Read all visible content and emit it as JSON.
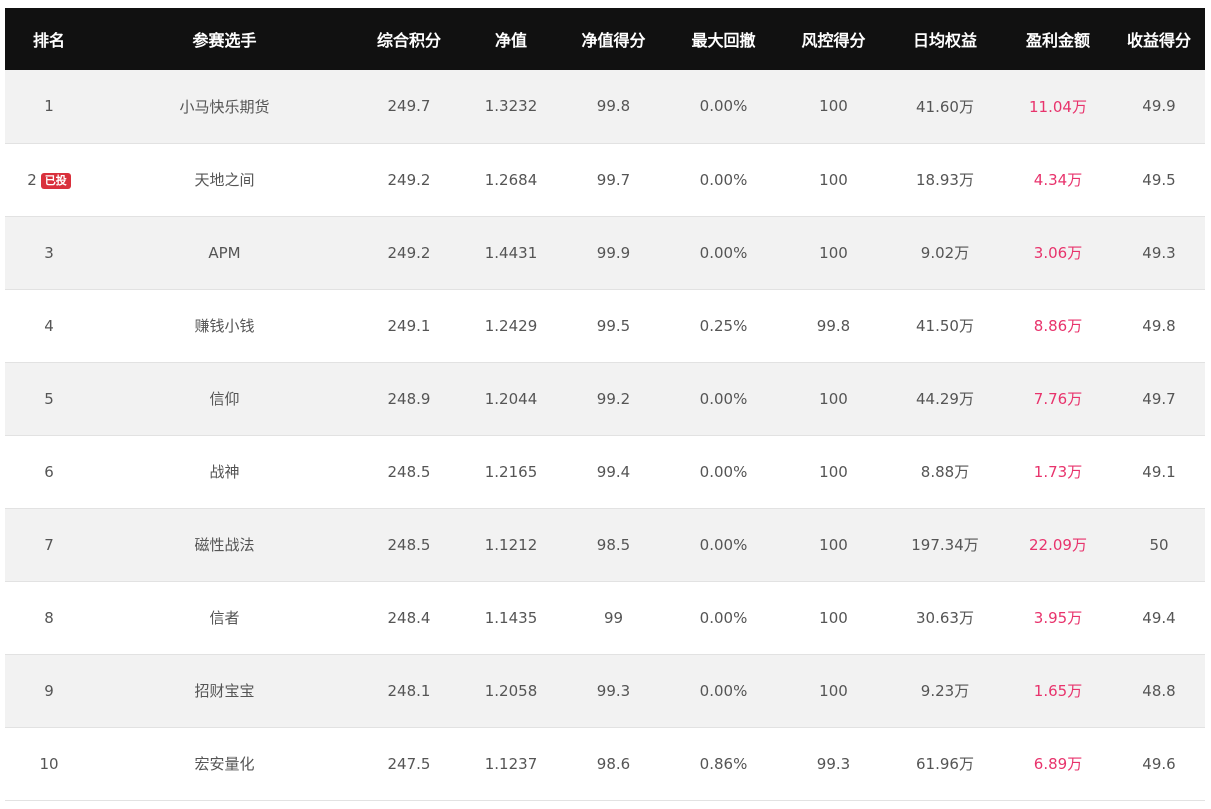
{
  "columns": [
    "排名",
    "参赛选手",
    "综合积分",
    "净值",
    "净值得分",
    "最大回撤",
    "风控得分",
    "日均权益",
    "盈利金额",
    "收益得分"
  ],
  "rows": [
    {
      "rank": "1",
      "badge": "",
      "name": "小马快乐期货",
      "score": "249.7",
      "nav": "1.3232",
      "nav_score": "99.8",
      "drawdown": "0.00%",
      "risk_score": "100",
      "avg_equity": "41.60万",
      "profit": "11.04万",
      "return_score": "49.9"
    },
    {
      "rank": "2",
      "badge": "已投",
      "name": "天地之间",
      "score": "249.2",
      "nav": "1.2684",
      "nav_score": "99.7",
      "drawdown": "0.00%",
      "risk_score": "100",
      "avg_equity": "18.93万",
      "profit": "4.34万",
      "return_score": "49.5"
    },
    {
      "rank": "3",
      "badge": "",
      "name": "APM",
      "score": "249.2",
      "nav": "1.4431",
      "nav_score": "99.9",
      "drawdown": "0.00%",
      "risk_score": "100",
      "avg_equity": "9.02万",
      "profit": "3.06万",
      "return_score": "49.3"
    },
    {
      "rank": "4",
      "badge": "",
      "name": "赚钱小钱",
      "score": "249.1",
      "nav": "1.2429",
      "nav_score": "99.5",
      "drawdown": "0.25%",
      "risk_score": "99.8",
      "avg_equity": "41.50万",
      "profit": "8.86万",
      "return_score": "49.8"
    },
    {
      "rank": "5",
      "badge": "",
      "name": "信仰",
      "score": "248.9",
      "nav": "1.2044",
      "nav_score": "99.2",
      "drawdown": "0.00%",
      "risk_score": "100",
      "avg_equity": "44.29万",
      "profit": "7.76万",
      "return_score": "49.7"
    },
    {
      "rank": "6",
      "badge": "",
      "name": "战神",
      "score": "248.5",
      "nav": "1.2165",
      "nav_score": "99.4",
      "drawdown": "0.00%",
      "risk_score": "100",
      "avg_equity": "8.88万",
      "profit": "1.73万",
      "return_score": "49.1"
    },
    {
      "rank": "7",
      "badge": "",
      "name": "磁性战法",
      "score": "248.5",
      "nav": "1.1212",
      "nav_score": "98.5",
      "drawdown": "0.00%",
      "risk_score": "100",
      "avg_equity": "197.34万",
      "profit": "22.09万",
      "return_score": "50"
    },
    {
      "rank": "8",
      "badge": "",
      "name": "信者",
      "score": "248.4",
      "nav": "1.1435",
      "nav_score": "99",
      "drawdown": "0.00%",
      "risk_score": "100",
      "avg_equity": "30.63万",
      "profit": "3.95万",
      "return_score": "49.4"
    },
    {
      "rank": "9",
      "badge": "",
      "name": "招财宝宝",
      "score": "248.1",
      "nav": "1.2058",
      "nav_score": "99.3",
      "drawdown": "0.00%",
      "risk_score": "100",
      "avg_equity": "9.23万",
      "profit": "1.65万",
      "return_score": "48.8"
    },
    {
      "rank": "10",
      "badge": "",
      "name": "宏安量化",
      "score": "247.5",
      "nav": "1.1237",
      "nav_score": "98.6",
      "drawdown": "0.86%",
      "risk_score": "99.3",
      "avg_equity": "61.96万",
      "profit": "6.89万",
      "return_score": "49.6"
    }
  ],
  "colors": {
    "header_bg": "#111111",
    "profit_text": "#e8336c",
    "badge_bg": "#d9303c",
    "row_alt": "#f2f2f2"
  }
}
